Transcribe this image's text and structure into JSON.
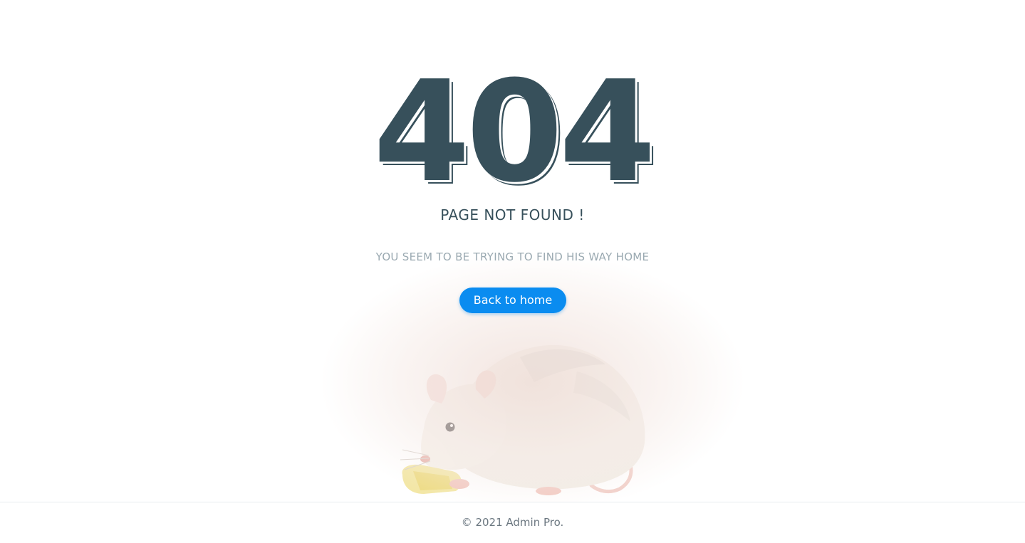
{
  "error": {
    "code": "404",
    "title": "PAGE NOT FOUND !",
    "subtitle": "YOU SEEM TO BE TRYING TO FIND HIS WAY HOME"
  },
  "actions": {
    "home_label": "Back to home"
  },
  "footer": {
    "copyright": "© 2021 Admin Pro."
  },
  "colors": {
    "heading": "#37505b",
    "muted": "#9aa9b1",
    "accent": "#0a8cf0",
    "background": "#ffffff"
  },
  "illustration": {
    "subject": "rat-eating-cheese-illustration"
  }
}
